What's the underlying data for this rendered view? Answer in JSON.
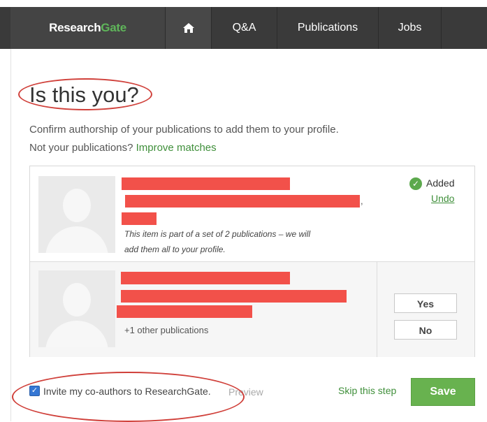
{
  "nav": {
    "brand_a": "Research",
    "brand_b": "Gate",
    "home_icon": "home-icon",
    "items": [
      "Q&A",
      "Publications",
      "Jobs"
    ]
  },
  "heading": "Is this you?",
  "intro": {
    "line1": "Confirm authorship of your publications to add them to your profile.",
    "line2_prefix": "Not your publications?",
    "improve_link": "Improve matches"
  },
  "items": [
    {
      "status_icon": "check-circle-icon",
      "added_label": "Added",
      "undo_label": "Undo",
      "note_line1": "This item is part of a set of 2 publications – we will",
      "note_line2": "add them all to your profile."
    },
    {
      "other_text": "+1 other publications",
      "yes_label": "Yes",
      "no_label": "No"
    }
  ],
  "footer": {
    "invite_checked": true,
    "invite_label": "Invite my co-authors to ResearchGate.",
    "preview_label": "Preview",
    "skip_label": "Skip this step",
    "save_label": "Save"
  },
  "colors": {
    "brand_green": "#5fb55a",
    "link_green": "#3f8f3a",
    "save_green": "#68b24f",
    "redaction": "#f2514a",
    "annotation": "#d0403a"
  }
}
